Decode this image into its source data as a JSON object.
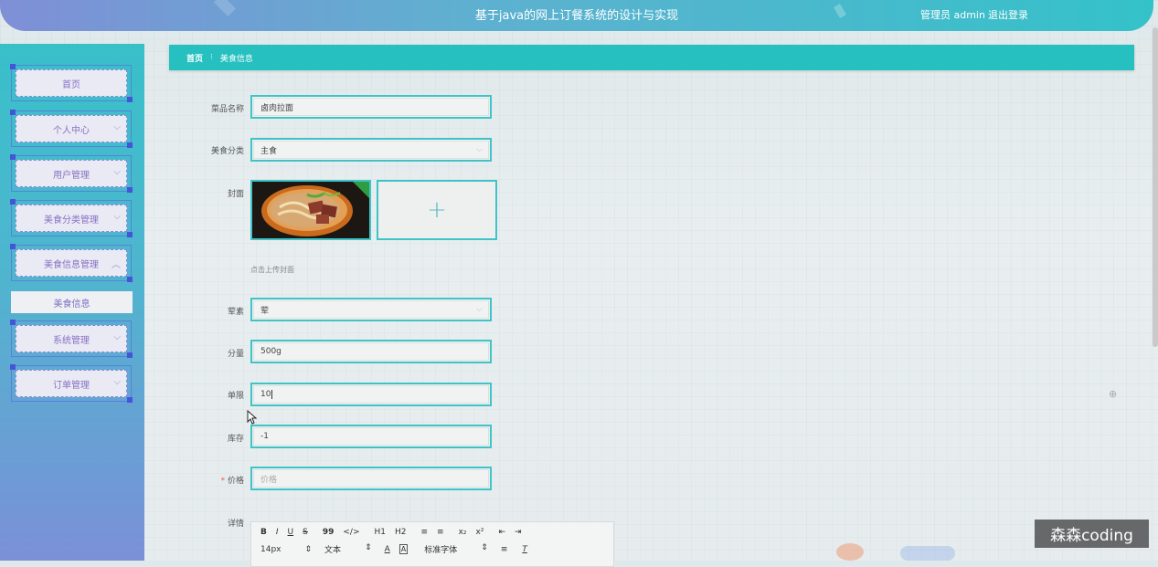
{
  "header": {
    "title": "基于java的网上订餐系统的设计与实现",
    "user": "管理员 admin",
    "logout": "退出登录"
  },
  "sidebar": {
    "items": [
      {
        "label": "首页"
      },
      {
        "label": "个人中心"
      },
      {
        "label": "用户管理"
      },
      {
        "label": "美食分类管理"
      },
      {
        "label": "美食信息管理"
      },
      {
        "label": "系统管理"
      },
      {
        "label": "订单管理"
      }
    ],
    "submenu": "美食信息"
  },
  "breadcrumb": {
    "home": "首页",
    "current": "美食信息"
  },
  "form": {
    "name_label": "菜品名称",
    "name_value": "卤肉拉面",
    "category_label": "美食分类",
    "category_value": "主食",
    "cover_label": "封面",
    "upload_hint": "点击上传封面",
    "meat_label": "荤素",
    "meat_value": "荤",
    "portion_label": "分量",
    "portion_value": "500g",
    "limit_label": "单限",
    "limit_value": "10",
    "stock_label": "库存",
    "stock_value": "-1",
    "price_label": "价格",
    "price_placeholder": "价格",
    "detail_label": "详情"
  },
  "editor": {
    "toolbar_row1": [
      "B",
      "I",
      "U",
      "S",
      "99",
      "</>",
      "H1",
      "H2",
      "≡",
      "≡",
      "x₂",
      "x²",
      "⇤",
      "⇥"
    ],
    "font_size": "14px",
    "block_type": "文本",
    "font_family": "标准字体"
  },
  "watermark": "森森coding"
}
